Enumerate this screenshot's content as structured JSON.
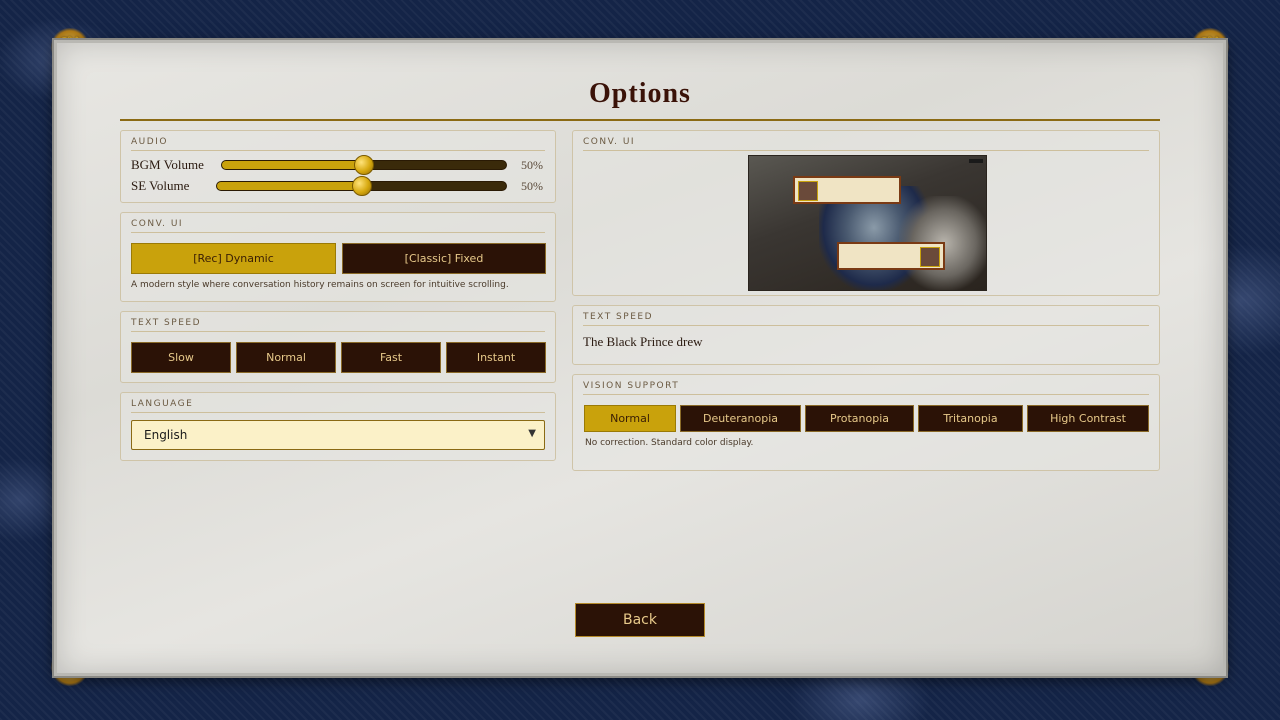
{
  "title": "Options",
  "audio": {
    "label": "AUDIO",
    "bgm": {
      "label": "BGM Volume",
      "value_text": "50%",
      "level": 0.5
    },
    "se": {
      "label": "SE Volume",
      "value_text": "50%",
      "level": 0.5
    }
  },
  "conv_ui": {
    "label": "CONV. UI",
    "options": [
      "[Rec] Dynamic",
      "[Classic] Fixed"
    ],
    "selected": "[Rec] Dynamic",
    "description": "A modern style where conversation history remains on screen for intuitive scrolling."
  },
  "text_speed": {
    "label": "TEXT SPEED",
    "options": [
      "Slow",
      "Normal",
      "Fast",
      "Instant"
    ]
  },
  "language": {
    "label": "LANGUAGE",
    "selected": "English"
  },
  "conv_preview": {
    "label": "CONV. UI"
  },
  "text_speed_preview": {
    "label": "TEXT SPEED",
    "sample": "The Black Prince drew"
  },
  "vision": {
    "label": "VISION SUPPORT",
    "options": [
      "Normal",
      "Deuteranopia",
      "Protanopia",
      "Tritanopia",
      "High Contrast"
    ],
    "selected": "Normal",
    "description": "No correction. Standard color display."
  },
  "back_label": "Back",
  "colors": {
    "gold": "#c9a20c",
    "dark_brown": "#2b1206",
    "title": "#3a1208",
    "background_navy": "#142447"
  },
  "icons": {
    "corner": "gold-scroll-ornament-icon",
    "chevron": "chevron-down-icon",
    "cursor": "mouse-pointer-icon"
  }
}
